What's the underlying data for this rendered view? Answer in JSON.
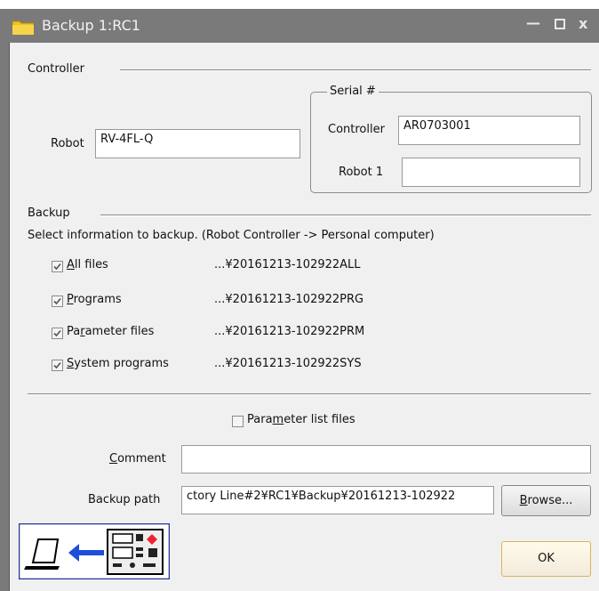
{
  "window": {
    "title": "Backup 1:RC1",
    "controls": {
      "minimize": "—",
      "maximize": "▫",
      "close": "x"
    }
  },
  "controller": {
    "section_label": "Controller",
    "robot_label": "Robot",
    "robot_value": "RV-4FL-Q",
    "serial": {
      "group_label": "Serial #",
      "controller_label": "Controller",
      "controller_value": "AR0703001",
      "robot1_label": "Robot 1",
      "robot1_value": ""
    }
  },
  "backup": {
    "section_label": "Backup",
    "instruction": "Select information to backup. (Robot Controller -> Personal computer)",
    "items": [
      {
        "label_pre": "",
        "label_ul": "A",
        "label_post": "ll files",
        "checked": true,
        "path": "...¥20161213-102922ALL"
      },
      {
        "label_pre": "",
        "label_ul": "P",
        "label_post": "rograms",
        "checked": true,
        "path": "...¥20161213-102922PRG"
      },
      {
        "label_pre": "Pa",
        "label_ul": "r",
        "label_post": "ameter files",
        "checked": true,
        "path": "...¥20161213-102922PRM"
      },
      {
        "label_pre": "",
        "label_ul": "S",
        "label_post": "ystem programs",
        "checked": true,
        "path": "...¥20161213-102922SYS"
      }
    ],
    "param_list": {
      "label_pre": "Para",
      "label_ul": "m",
      "label_post": "eter list files",
      "checked": false
    },
    "comment": {
      "label_ul": "C",
      "label_post": "omment",
      "value": ""
    },
    "backup_path": {
      "label": "Backup path",
      "value": "ctory Line#2¥RC1¥Backup¥20161213-102922"
    },
    "browse_button": {
      "label_ul": "B",
      "label_post": "rowse..."
    },
    "ok_button": "OK"
  }
}
